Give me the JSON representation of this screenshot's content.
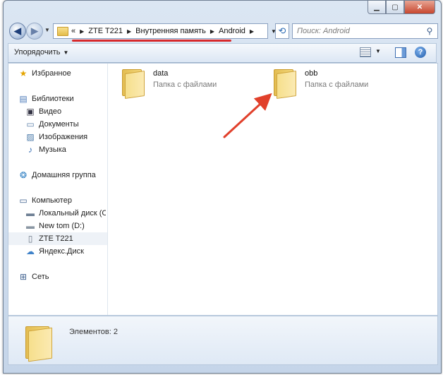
{
  "window": {
    "minimize_icon": "minimize-icon",
    "maximize_icon": "maximize-icon",
    "close_icon": "close-icon"
  },
  "address": {
    "overflow": "«",
    "crumbs": [
      "ZTE T221",
      "Внутренняя память",
      "Android"
    ],
    "highlight_color": "#d8292b"
  },
  "search": {
    "placeholder": "Поиск: Android"
  },
  "toolbar": {
    "organize_label": "Упорядочить"
  },
  "sidebar": {
    "items": [
      {
        "label": "Избранное",
        "icon": "star-icon"
      },
      {
        "label": "Библиотеки",
        "icon": "libraries-icon"
      },
      {
        "label": "Видео",
        "icon": "video-icon"
      },
      {
        "label": "Документы",
        "icon": "documents-icon"
      },
      {
        "label": "Изображения",
        "icon": "pictures-icon"
      },
      {
        "label": "Музыка",
        "icon": "music-icon"
      },
      {
        "label": "Домашняя группа",
        "icon": "homegroup-icon"
      },
      {
        "label": "Компьютер",
        "icon": "computer-icon"
      },
      {
        "label": "Локальный диск (C",
        "icon": "local-disk-icon"
      },
      {
        "label": "New tom (D:)",
        "icon": "drive-icon"
      },
      {
        "label": "ZTE T221",
        "icon": "phone-icon"
      },
      {
        "label": "Яндекс.Диск",
        "icon": "yandex-disk-icon"
      },
      {
        "label": "Сеть",
        "icon": "network-icon"
      }
    ]
  },
  "files": [
    {
      "name": "data",
      "type": "Папка с файлами"
    },
    {
      "name": "obb",
      "type": "Папка с файлами"
    }
  ],
  "details": {
    "count_label": "Элементов: 2"
  },
  "annotation": {
    "arrow_color": "#e1402b"
  }
}
